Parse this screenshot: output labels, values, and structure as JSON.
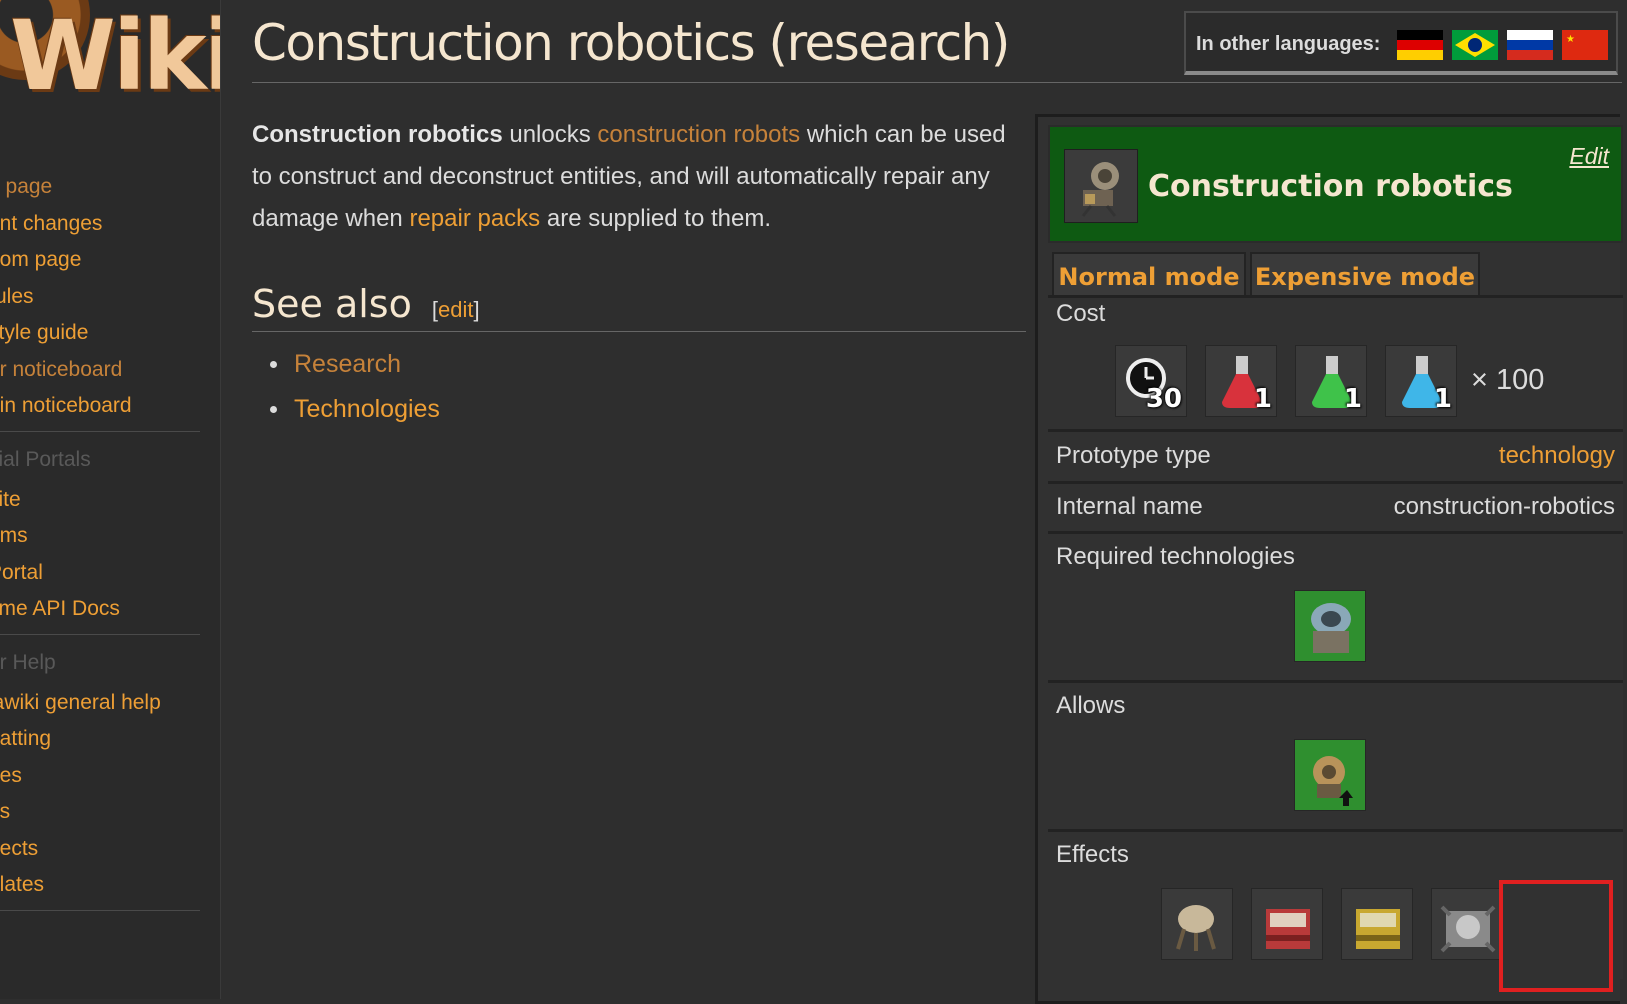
{
  "sidebar": {
    "logo_text": "Wiki",
    "nav": [
      "n page",
      "ent changes",
      "dom page",
      " rules",
      " style guide",
      "or noticeboard",
      "nin noticeboard"
    ],
    "portals_head": "cial Portals",
    "portals": [
      "site",
      "ums",
      " Portal",
      "time API Docs"
    ],
    "help_head": "or Help",
    "help": [
      "iawiki general help",
      "natting",
      "ges",
      "es",
      "irects",
      "plates"
    ]
  },
  "page": {
    "title": "Construction robotics (research)",
    "languages_label": "In other languages:",
    "intro": {
      "bold": "Construction robotics",
      "t1": " unlocks ",
      "link1": "construction robots",
      "t2": " which can be used to construct and deconstruct entities, and will automatically repair any damage when ",
      "link2": "repair packs",
      "t3": " are supplied to them."
    },
    "see_also": "See also",
    "edit_open": "[",
    "edit": "edit",
    "edit_close": "]",
    "see_also_items": [
      "Research",
      "Technologies"
    ]
  },
  "infobox": {
    "title": "Construction robotics",
    "edit": "Edit",
    "tabs": [
      "Normal mode",
      "Expensive mode"
    ],
    "cost_label": "Cost",
    "cost_items": [
      {
        "icon": "clock-icon",
        "count": "30"
      },
      {
        "icon": "red-science-pack-icon",
        "count": "1"
      },
      {
        "icon": "green-science-pack-icon",
        "count": "1"
      },
      {
        "icon": "blue-science-pack-icon",
        "count": "1"
      }
    ],
    "multiplier": "× 100",
    "prototype_label": "Prototype type",
    "prototype_value": "technology",
    "internal_label": "Internal name",
    "internal_value": "construction-robotics",
    "required_label": "Required technologies",
    "allows_label": "Allows",
    "effects_label": "Effects"
  },
  "colors": {
    "link": "#ee9f35",
    "visited": "#c6823a",
    "header_green": "#0e5a12",
    "highlight": "#e02020"
  }
}
